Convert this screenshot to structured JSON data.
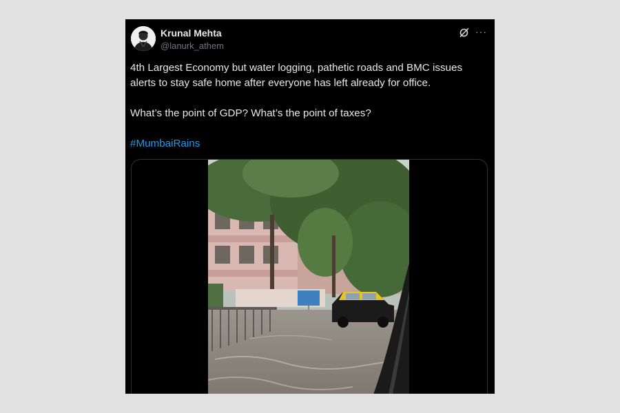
{
  "tweet": {
    "author": {
      "display_name": "Krunal Mehta",
      "handle": "@lanurk_athem"
    },
    "text_lines": [
      "4th Largest Economy but water logging, pathetic roads and BMC issues alerts to stay safe home after everyone has left already for office.",
      "What’s the point of GDP? What’s the point of taxes?"
    ],
    "hashtag": "#MumbaiRains",
    "actions": {
      "grok_icon": "grok-slash-circle-icon",
      "more_icon": "more-horizontal-icon",
      "more_glyph": "···"
    },
    "media": {
      "type": "video",
      "scene": "flooded-street-with-taxi"
    }
  },
  "colors": {
    "page_background": "#e1e1e1",
    "card_background": "#000000",
    "text": "#e7e9ea",
    "muted_text": "#71767b",
    "link": "#1d9bf0",
    "border": "#2f3336"
  }
}
